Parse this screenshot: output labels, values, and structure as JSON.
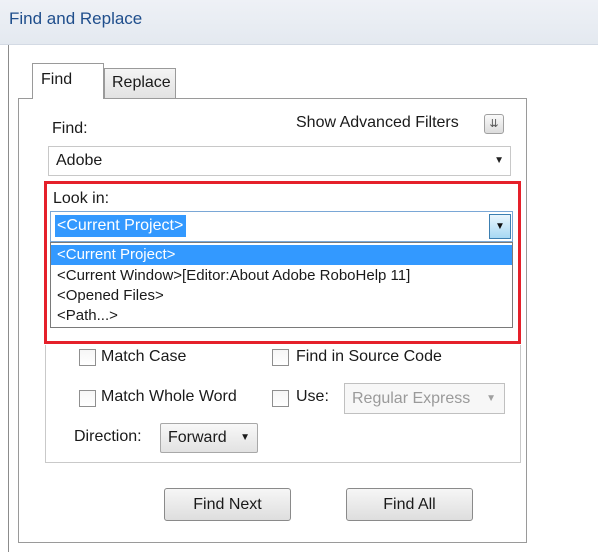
{
  "window": {
    "title": "Find and Replace"
  },
  "tabs": [
    {
      "label": "Find",
      "active": true
    },
    {
      "label": "Replace",
      "active": false
    }
  ],
  "find": {
    "label": "Find:",
    "value": "Adobe",
    "advanced_filters_label": "Show Advanced Filters",
    "advanced_filters_icon": "double-chevron-down-icon"
  },
  "look_in": {
    "label": "Look in:",
    "selected": "<Current Project>",
    "options": [
      "<Current Project>",
      "<Current Window>[Editor:About Adobe RoboHelp 11]",
      "<Opened Files>",
      "<Path...>"
    ],
    "highlight_color": "#e5202a"
  },
  "options": {
    "match_case": {
      "label": "Match Case",
      "checked": false
    },
    "match_whole_word": {
      "label": "Match Whole Word",
      "checked": false
    },
    "find_in_source": {
      "label": "Find in Source Code",
      "checked": false
    },
    "use": {
      "label": "Use:",
      "checked": false,
      "value": "Regular Express",
      "disabled": true
    }
  },
  "direction": {
    "label": "Direction:",
    "value": "Forward"
  },
  "buttons": {
    "find_next": "Find Next",
    "find_all": "Find All"
  },
  "colors": {
    "selection": "#3399ff",
    "title": "#1f4e8c"
  }
}
